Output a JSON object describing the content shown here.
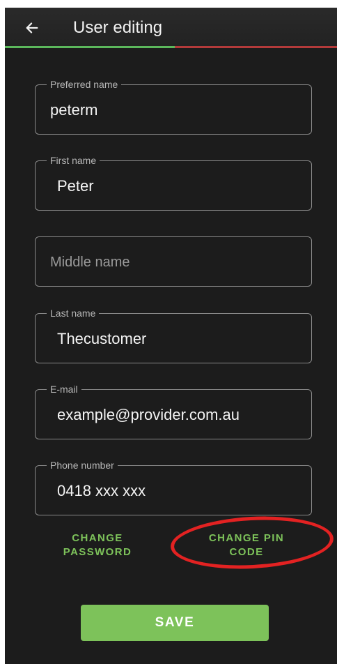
{
  "app_bar": {
    "title": "User editing",
    "back_icon": "arrow-left-icon"
  },
  "fields": [
    {
      "label": "Preferred name",
      "value": "peterm"
    },
    {
      "label": "First name",
      "value": "Peter"
    },
    {
      "label": "",
      "placeholder": "Middle name",
      "value": ""
    },
    {
      "label": "Last name",
      "value": "Thecustomer"
    },
    {
      "label": "E-mail",
      "value": "example@provider.com.au"
    },
    {
      "label": "Phone number",
      "value": "0418 xxx xxx"
    }
  ],
  "actions": {
    "change_password": {
      "line1": "CHANGE",
      "line2": "PASSWORD"
    },
    "change_pin": {
      "line1": "CHANGE PIN",
      "line2": "CODE"
    },
    "save": "SAVE"
  },
  "colors": {
    "background": "#1c1c1c",
    "accent_green": "#7dc25a",
    "accent_red": "#b33a3a",
    "annotation_red": "#e32222"
  }
}
